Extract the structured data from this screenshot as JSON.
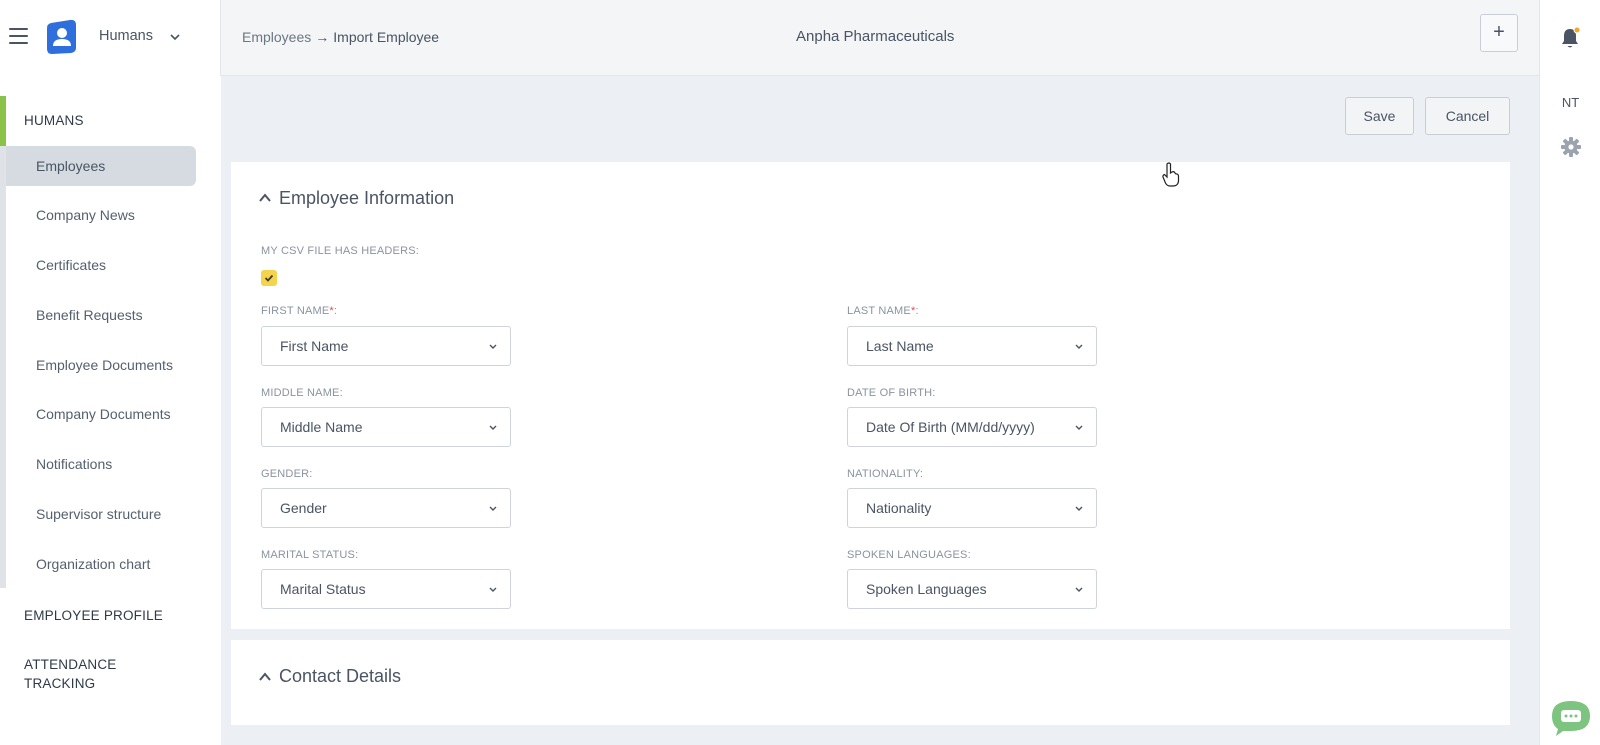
{
  "header": {
    "app_name": "Humans",
    "breadcrumb": {
      "parent": "Employees",
      "arrow": "→",
      "current": "Import Employee"
    },
    "company": "Anpha Pharmaceuticals",
    "add_label": "+"
  },
  "rightrail": {
    "initials": "NT"
  },
  "sidebar": {
    "section_humans": "HUMANS",
    "items": [
      {
        "label": "Employees",
        "active": true
      },
      {
        "label": "Company News"
      },
      {
        "label": "Certificates"
      },
      {
        "label": "Benefit Requests"
      },
      {
        "label": "Employee Documents"
      },
      {
        "label": "Company Documents"
      },
      {
        "label": "Notifications"
      },
      {
        "label": "Supervisor structure"
      },
      {
        "label": "Organization chart"
      }
    ],
    "section_profile": "EMPLOYEE PROFILE",
    "section_attendance_1": "ATTENDANCE",
    "section_attendance_2": "TRACKING"
  },
  "actions": {
    "save": "Save",
    "cancel": "Cancel"
  },
  "employee_info": {
    "title": "Employee Information",
    "csv_headers_label": "MY CSV FILE HAS HEADERS:",
    "csv_headers_checked": true,
    "fields": {
      "first_name": {
        "label": "FIRST NAME",
        "required": "*",
        "suffix": ":",
        "value": "First Name"
      },
      "last_name": {
        "label": "LAST NAME",
        "required": "*",
        "suffix": ":",
        "value": "Last Name"
      },
      "middle_name": {
        "label": "MIDDLE NAME:",
        "value": "Middle Name"
      },
      "date_of_birth": {
        "label": "DATE OF BIRTH:",
        "value": "Date Of Birth (MM/dd/yyyy)"
      },
      "gender": {
        "label": "GENDER:",
        "value": "Gender"
      },
      "nationality": {
        "label": "NATIONALITY:",
        "value": "Nationality"
      },
      "marital_status": {
        "label": "MARITAL STATUS:",
        "value": "Marital Status"
      },
      "spoken_languages": {
        "label": "SPOKEN LANGUAGES:",
        "value": "Spoken Languages"
      }
    }
  },
  "contact_details": {
    "title": "Contact Details"
  },
  "colors": {
    "accent_green": "#8bc34a",
    "checkbox_yellow": "#f5d34a",
    "logo_blue": "#2f6fdd",
    "notify_orange": "#f5a623",
    "chat_green": "#7cc47f"
  },
  "icons": [
    "hamburger-icon",
    "humans-logo-icon",
    "chevron-down-icon",
    "bell-icon",
    "gear-icon",
    "chat-icon",
    "chevron-up-icon",
    "check-icon",
    "hand-cursor-icon"
  ]
}
